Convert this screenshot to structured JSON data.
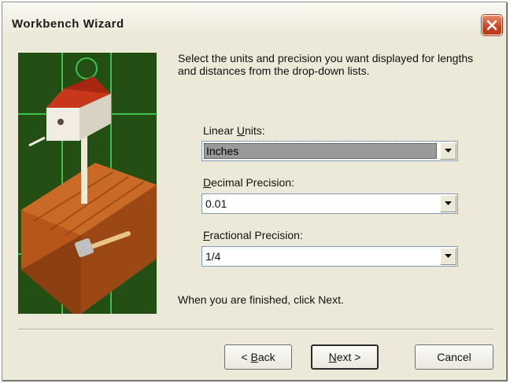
{
  "window": {
    "title": "Workbench Wizard"
  },
  "intro_text": "Select the units and precision you want displayed for lengths and distances from the drop-down lists.",
  "fields": {
    "linear_units": {
      "label_pre": "Linear ",
      "label_key": "U",
      "label_post": "nits:",
      "value": "Inches"
    },
    "decimal_precision": {
      "label_pre": "",
      "label_key": "D",
      "label_post": "ecimal Precision:",
      "value": "0.01"
    },
    "fractional_precision": {
      "label_pre": "",
      "label_key": "F",
      "label_post": "ractional Precision:",
      "value": "1/4"
    }
  },
  "finish_text": "When you are finished, click Next.",
  "buttons": {
    "back": {
      "pre": "< ",
      "key": "B",
      "post": "ack"
    },
    "next": {
      "pre": "",
      "key": "N",
      "post": "ext >"
    },
    "cancel": {
      "label": "Cancel"
    }
  },
  "icons": {
    "close": "close-icon",
    "dropdown": "chevron-down-icon"
  },
  "colors": {
    "dialog_bg": "#ece9d8",
    "close_button": "#c9441e",
    "selection": "#9a9a9a"
  }
}
